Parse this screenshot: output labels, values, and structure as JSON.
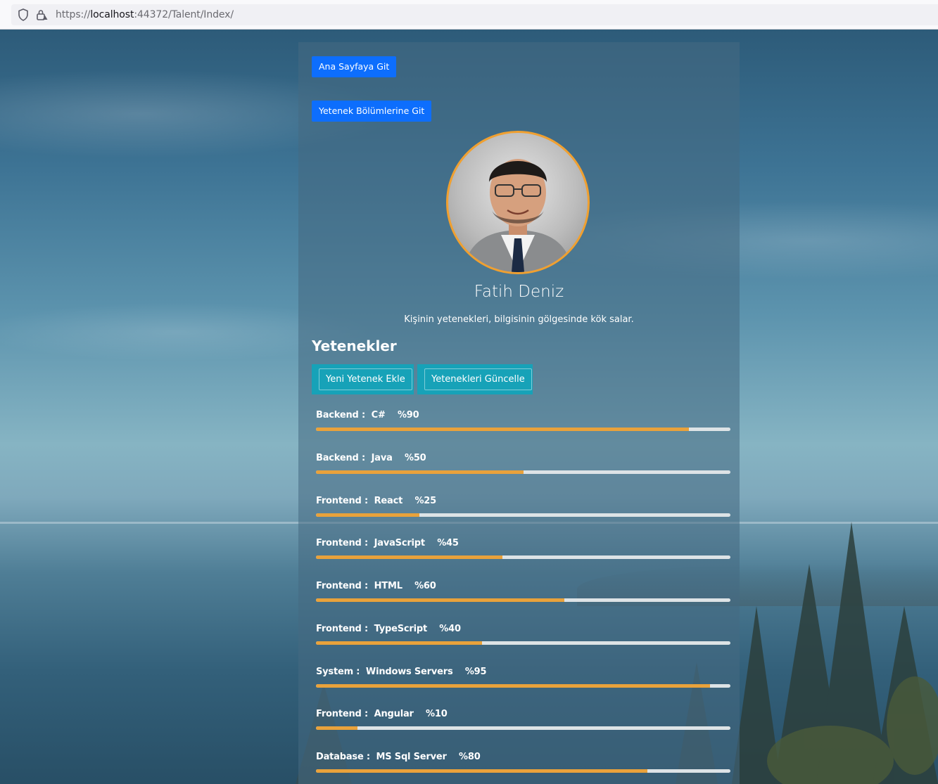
{
  "browser": {
    "url_prefix": "https://",
    "url_host": "localhost",
    "url_rest": ":44372/Talent/Index/"
  },
  "nav": {
    "home_button": "Ana Sayfaya Git",
    "sections_button": "Yetenek Bölümlerine Git"
  },
  "profile": {
    "name": "Fatih Deniz",
    "quote": "Kişinin yetenekleri, bilgisinin gölgesinde kök salar."
  },
  "skills_section": {
    "title": "Yetenekler",
    "add_button": "Yeni Yetenek Ekle",
    "update_button": "Yetenekleri Güncelle",
    "items": [
      {
        "label": "Backend :  C#    %90",
        "percent": 90
      },
      {
        "label": "Backend :  Java    %50",
        "percent": 50
      },
      {
        "label": "Frontend :  React    %25",
        "percent": 25
      },
      {
        "label": "Frontend :  JavaScript    %45",
        "percent": 45
      },
      {
        "label": "Frontend :  HTML    %60",
        "percent": 60
      },
      {
        "label": "Frontend :  TypeScript    %40",
        "percent": 40
      },
      {
        "label": "System :  Windows Servers    %95",
        "percent": 95
      },
      {
        "label": "Frontend :  Angular    %10",
        "percent": 10
      },
      {
        "label": "Database :  MS Sql Server    %80",
        "percent": 80
      }
    ]
  },
  "colors": {
    "primary_button": "#0d6efd",
    "info_button": "#17a2b8",
    "progress_fill": "#e9a23b",
    "progress_track": "#dde3e6",
    "avatar_border": "#f0a030"
  },
  "icons": [
    "shield-icon",
    "lock-icon"
  ]
}
